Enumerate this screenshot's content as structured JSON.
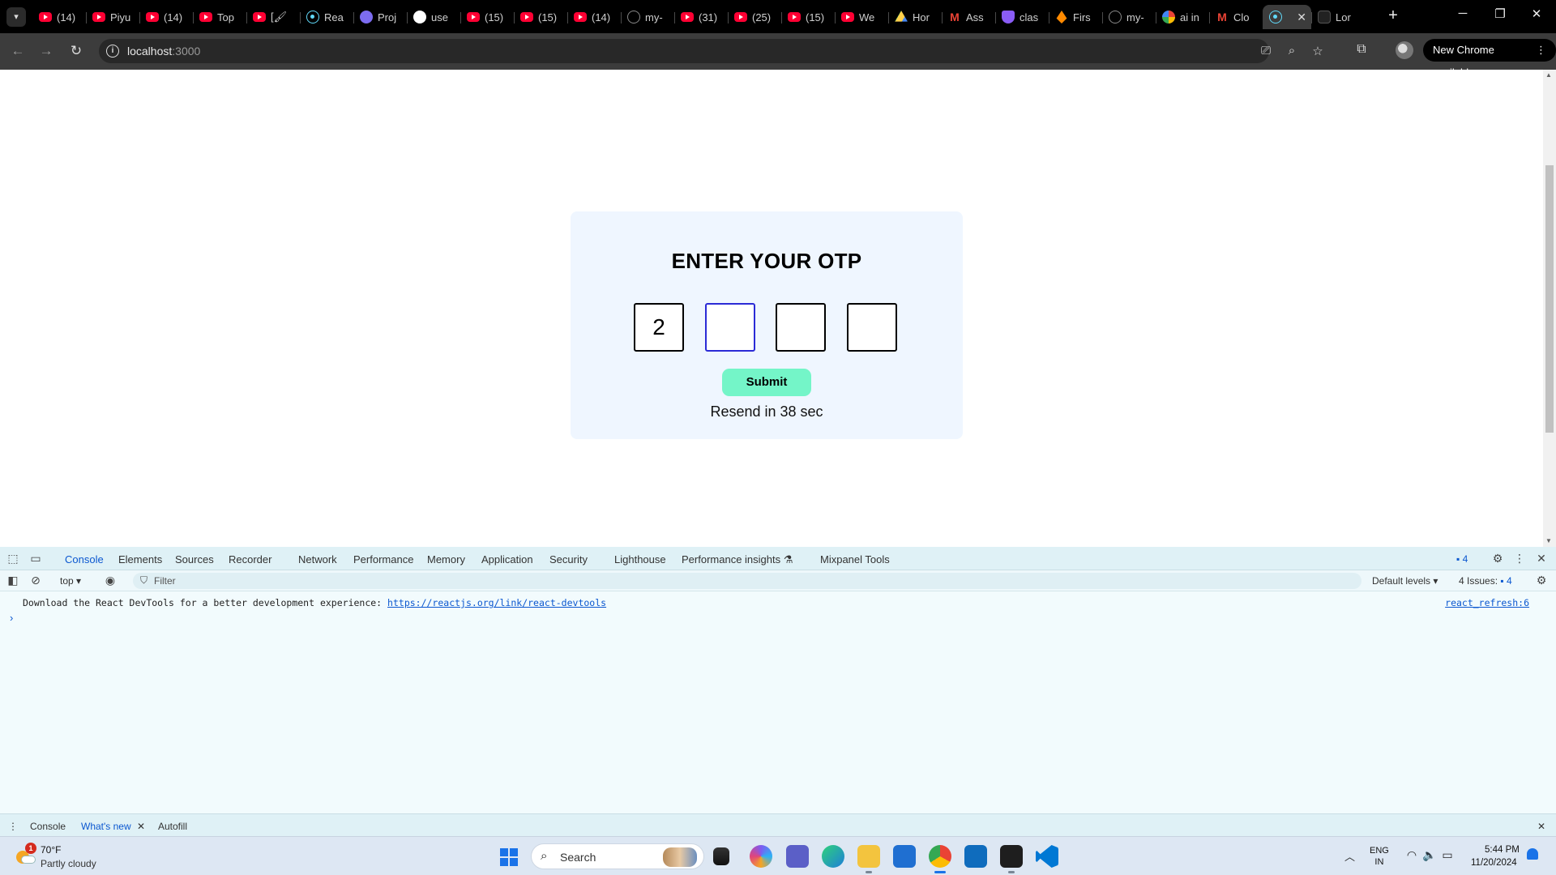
{
  "browser": {
    "tabs": [
      {
        "title": "(14)",
        "favicon": "youtube"
      },
      {
        "title": "Piyu",
        "favicon": "youtube"
      },
      {
        "title": "(14)",
        "favicon": "youtube"
      },
      {
        "title": "Top",
        "favicon": "youtube"
      },
      {
        "title": "[🖌",
        "favicon": "youtube"
      },
      {
        "title": "Rea",
        "favicon": "react"
      },
      {
        "title": "Proj",
        "favicon": "purple"
      },
      {
        "title": "use",
        "favicon": "openai"
      },
      {
        "title": "(15)",
        "favicon": "youtube"
      },
      {
        "title": "(15)",
        "favicon": "youtube"
      },
      {
        "title": "(14)",
        "favicon": "youtube"
      },
      {
        "title": "my-",
        "favicon": "github"
      },
      {
        "title": "(31)",
        "favicon": "youtube"
      },
      {
        "title": "(25)",
        "favicon": "youtube"
      },
      {
        "title": "(15)",
        "favicon": "youtube"
      },
      {
        "title": "We",
        "favicon": "youtube"
      },
      {
        "title": "Hor",
        "favicon": "drive"
      },
      {
        "title": "Ass",
        "favicon": "gmail"
      },
      {
        "title": "clas",
        "favicon": "shield"
      },
      {
        "title": "Firs",
        "favicon": "fire"
      },
      {
        "title": "my-",
        "favicon": "github"
      },
      {
        "title": "ai in",
        "favicon": "google"
      },
      {
        "title": "Clo",
        "favicon": "gmail"
      },
      {
        "title": "",
        "favicon": "react",
        "active": true
      },
      {
        "title": "Lor",
        "favicon": "dark"
      }
    ],
    "url_host": "localhost",
    "url_port": ":3000",
    "update_button": "New Chrome available"
  },
  "page": {
    "title": "ENTER YOUR OTP",
    "otp_digits": [
      "2",
      "",
      "",
      ""
    ],
    "submit_label": "Submit",
    "resend_text": "Resend in 38 sec"
  },
  "devtools": {
    "tabs": [
      "Console",
      "Elements",
      "Sources",
      "Recorder",
      "Network",
      "Performance",
      "Memory",
      "Application",
      "Security",
      "Lighthouse",
      "Performance insights ⚗",
      "Mixpanel Tools"
    ],
    "active_tab": "Console",
    "issues_badge": "4",
    "context": "top",
    "filter_placeholder": "Filter",
    "levels": "Default levels",
    "issues_label": "4 Issues:",
    "issues_count": "4",
    "message_text": "Download the React DevTools for a better development experience: ",
    "message_link": "https://reactjs.org/link/react-devtools",
    "message_source": "react_refresh:6",
    "drawer_tabs": [
      "Console",
      "What's new",
      "Autofill"
    ]
  },
  "taskbar": {
    "weather_temp": "70°F",
    "weather_desc": "Partly cloudy",
    "weather_badge": "1",
    "search_label": "Search",
    "lang_line1": "ENG",
    "lang_line2": "IN",
    "time": "5:44 PM",
    "date": "11/20/2024"
  },
  "colors": {
    "card_bg": "#eff6ff",
    "submit_bg": "#74f5c8",
    "focused_border": "#2b2bd6",
    "devtools_accent": "#0b57d0"
  }
}
